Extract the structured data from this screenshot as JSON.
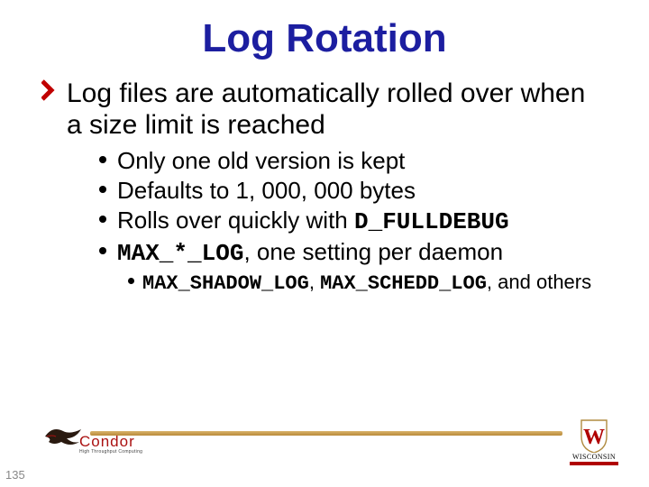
{
  "title": "Log Rotation",
  "l1": "Log files are automatically rolled over when a size limit is reached",
  "l2": {
    "a": "Only one old version is kept",
    "b": "Defaults to 1, 000, 000 bytes",
    "c_pre": "Rolls over quickly with ",
    "c_code": "D_FULLDEBUG",
    "d_code": "MAX_*_LOG",
    "d_post": ", one setting per daemon"
  },
  "l3": {
    "a_code1": "MAX_SHADOW_LOG",
    "a_mid": ", ",
    "a_code2": "MAX_SCHEDD_LOG",
    "a_post": ", and others"
  },
  "footer": {
    "condor": "Condor",
    "condor_sub": "High Throughput Computing",
    "wisc": "WISCONSIN"
  },
  "page": "135"
}
